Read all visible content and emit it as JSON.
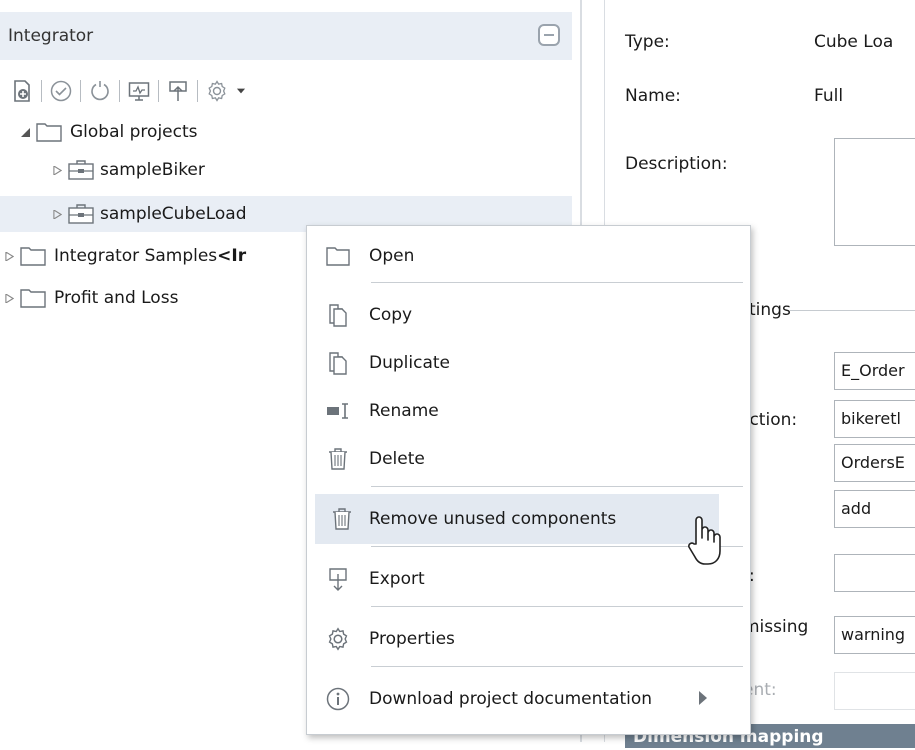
{
  "left_panel": {
    "title": "Integrator",
    "toolbar_icons": [
      "new-project-icon",
      "validate-icon",
      "refresh-icon",
      "deploy-icon",
      "export-icon",
      "settings-icon",
      "dropdown-arrow-icon"
    ],
    "tree": [
      {
        "label": "Global projects",
        "expanded": true
      },
      {
        "label": "sampleBiker"
      },
      {
        "label": "sampleCubeLoad",
        "selected": true
      },
      {
        "label": "Integrator Samples ",
        "label_bold": "<Ir"
      },
      {
        "label": "Profit and Loss"
      }
    ]
  },
  "right_panel": {
    "type_label": "Type:",
    "type_value": "Cube Loa",
    "name_label": "Name:",
    "name_value": "Full",
    "description_label": "Description:",
    "settings_legend": "tings",
    "connection_label": "ection:",
    "colon_label": ":",
    "missing_label": "missing",
    "parent_label": "ent:",
    "fields": [
      "E_Order",
      "bikeretl",
      "OrdersE",
      "add",
      "",
      "warning",
      ""
    ],
    "section_header": "Dimension mapping"
  },
  "context_menu": {
    "items": [
      {
        "label": "Open",
        "icon": "folder-icon"
      },
      {
        "label": "Copy",
        "icon": "copy-icon"
      },
      {
        "label": "Duplicate",
        "icon": "duplicate-icon"
      },
      {
        "label": "Rename",
        "icon": "rename-icon"
      },
      {
        "label": "Delete",
        "icon": "trash-icon"
      },
      {
        "label": "Remove unused components",
        "icon": "trash-icon",
        "hovered": true
      },
      {
        "label": "Export",
        "icon": "export-icon"
      },
      {
        "label": "Properties",
        "icon": "gear-icon"
      },
      {
        "label": "Download project documentation",
        "icon": "info-icon",
        "submenu": true
      }
    ]
  },
  "colors": {
    "selection": "#e9eef5",
    "hover": "#e3e9f1",
    "section_header": "#6f8090",
    "icon": "#6c737a"
  }
}
